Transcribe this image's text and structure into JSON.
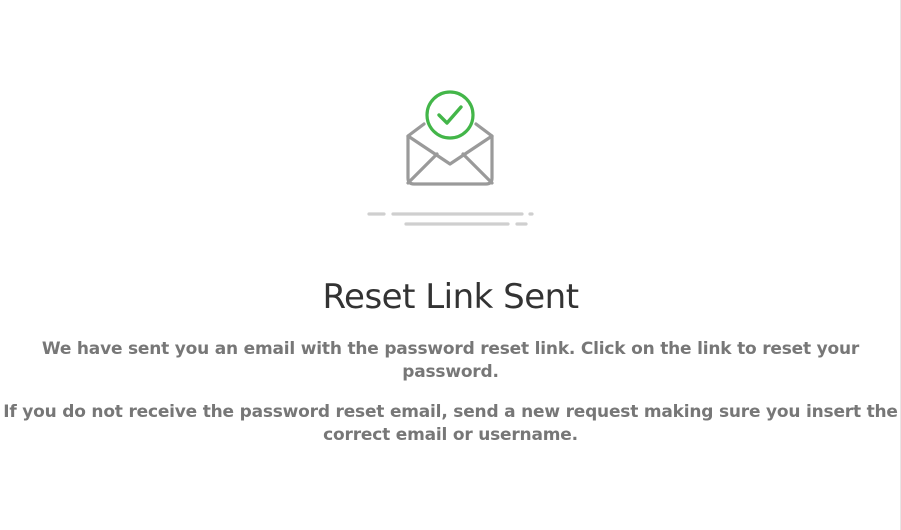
{
  "icons": {
    "envelope": "envelope-open-icon",
    "check": "check-circle-icon"
  },
  "colors": {
    "check_green": "#43b649",
    "envelope_gray": "#9a9a9a",
    "title_text": "#333333",
    "body_text": "#777777"
  },
  "main": {
    "title": "Reset Link Sent",
    "message_1": {
      "line_1": "We have sent you an email with the password reset link. Click on the link to reset your",
      "line_2": "password."
    },
    "message_2": {
      "line_1": "If you do not receive the password reset email, send a new request making sure you insert the",
      "line_2": "correct email or username."
    }
  }
}
